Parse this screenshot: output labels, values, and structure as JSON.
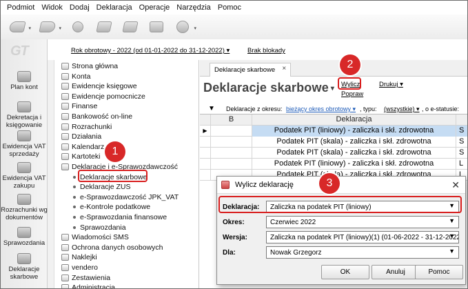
{
  "menu": [
    "Podmiot",
    "Widok",
    "Dodaj",
    "Deklaracja",
    "Operacje",
    "Narzędzia",
    "Pomoc"
  ],
  "toolbar_icons": [
    "nav-back-icon",
    "nav-forward-icon",
    "coins-icon",
    "eraser-icon",
    "bookmarks-icon",
    "printer-icon",
    "help-icon"
  ],
  "logo": "GT",
  "leftnav": [
    {
      "label": "Plan kont",
      "icon": "plan-kont-icon"
    },
    {
      "label": "Dekretacja i księgowanie",
      "icon": "dekretacja-icon"
    },
    {
      "label": "Ewidencja VAT sprzedaży",
      "icon": "vat-sprzedaz-icon"
    },
    {
      "label": "Ewidencja VAT zakupu",
      "icon": "vat-zakup-icon"
    },
    {
      "label": "Rozrachunki wg dokumentów",
      "icon": "rozrachunki-icon"
    },
    {
      "label": "Sprawozdania",
      "icon": "sprawozdania-icon"
    },
    {
      "label": "Deklaracje skarbowe",
      "icon": "deklaracje-icon"
    }
  ],
  "infobar": {
    "year": "Rok obrotowy - 2022  (od 01-01-2022 do 31-12-2022) ▾",
    "block": "Brak blokady"
  },
  "tree": [
    {
      "label": "Strona główna",
      "type": "icon"
    },
    {
      "label": "Konta",
      "type": "icon"
    },
    {
      "label": "Ewidencje księgowe",
      "type": "icon"
    },
    {
      "label": "Ewidencje pomocnicze",
      "type": "icon"
    },
    {
      "label": "Finanse",
      "type": "icon"
    },
    {
      "label": "Bankowość on-line",
      "type": "icon"
    },
    {
      "label": "Rozrachunki",
      "type": "icon"
    },
    {
      "label": "Działania",
      "type": "icon"
    },
    {
      "label": "Kalendarz",
      "type": "icon"
    },
    {
      "label": "Kartoteki",
      "type": "icon"
    },
    {
      "label": "Deklaracje i e-Sprawozdawczość",
      "type": "icon"
    },
    {
      "label": "Deklaracje skarbowe",
      "type": "dot"
    },
    {
      "label": "Deklaracje ZUS",
      "type": "dot"
    },
    {
      "label": "e-Sprawozdawczość JPK_VAT",
      "type": "dot"
    },
    {
      "label": "e-Kontrole podatkowe",
      "type": "dot"
    },
    {
      "label": "e-Sprawozdania finansowe",
      "type": "dot"
    },
    {
      "label": "Sprawozdania",
      "type": "dot"
    },
    {
      "label": "Wiadomości SMS",
      "type": "icon"
    },
    {
      "label": "Ochrona danych osobowych",
      "type": "icon"
    },
    {
      "label": "Naklejki",
      "type": "icon"
    },
    {
      "label": "vendero",
      "type": "icon"
    },
    {
      "label": "Zestawienia",
      "type": "icon"
    },
    {
      "label": "Administracja",
      "type": "icon"
    }
  ],
  "main": {
    "tab": "Deklaracje skarbowe",
    "title": "Deklaracje skarbowe",
    "links": {
      "wylicz": "Wylicz",
      "drukuj": "Drukuj",
      "popraw": "Popraw"
    },
    "filters": {
      "okres_label": "Deklaracje z okresu:",
      "okres_value": "bieżący okres obrotowy",
      "typ_label": ", typu:",
      "typ_value": "(wszystkie)",
      "status_label": ", o e-statusie:"
    },
    "columns": {
      "b": "B",
      "deklaracja": "Deklaracja"
    },
    "rows": [
      {
        "b": "",
        "deklaracja": "Podatek PIT (liniowy) - zaliczka i skł. zdrowotna",
        "s": "S",
        "selected": true
      },
      {
        "b": "",
        "deklaracja": "Podatek PIT (skala) - zaliczka i skł. zdrowotna",
        "s": "S",
        "selected": false
      },
      {
        "b": "",
        "deklaracja": "Podatek PIT (skala) - zaliczka i skł. zdrowotna",
        "s": "S",
        "selected": false
      },
      {
        "b": "",
        "deklaracja": "Podatek PIT (liniowy) - zaliczka i skł. zdrowotna",
        "s": "L",
        "selected": false
      },
      {
        "b": "",
        "deklaracja": "Podatek PIT (skala) - zaliczka i skł. zdrowotna",
        "s": "L",
        "selected": false
      }
    ]
  },
  "dialog": {
    "title": "Wylicz deklarację",
    "fields": [
      {
        "label": "Deklaracja:",
        "value": "Zaliczka na podatek PIT (liniowy)"
      },
      {
        "label": "Okres:",
        "value": "Czerwiec 2022"
      },
      {
        "label": "Wersja:",
        "value": "Zaliczka na podatek PIT (liniowy)(1) (01-06-2022 - 31-12-2022)"
      },
      {
        "label": "Dla:",
        "value": "Nowak Grzegorz"
      }
    ],
    "buttons": {
      "ok": "OK",
      "cancel": "Anuluj",
      "help": "Pomoc"
    }
  },
  "badges": [
    "1",
    "2",
    "3"
  ],
  "colors": {
    "highlight": "#d81d1d",
    "selection": "#c5dcf3",
    "link_blue": "#1e5bb8"
  }
}
